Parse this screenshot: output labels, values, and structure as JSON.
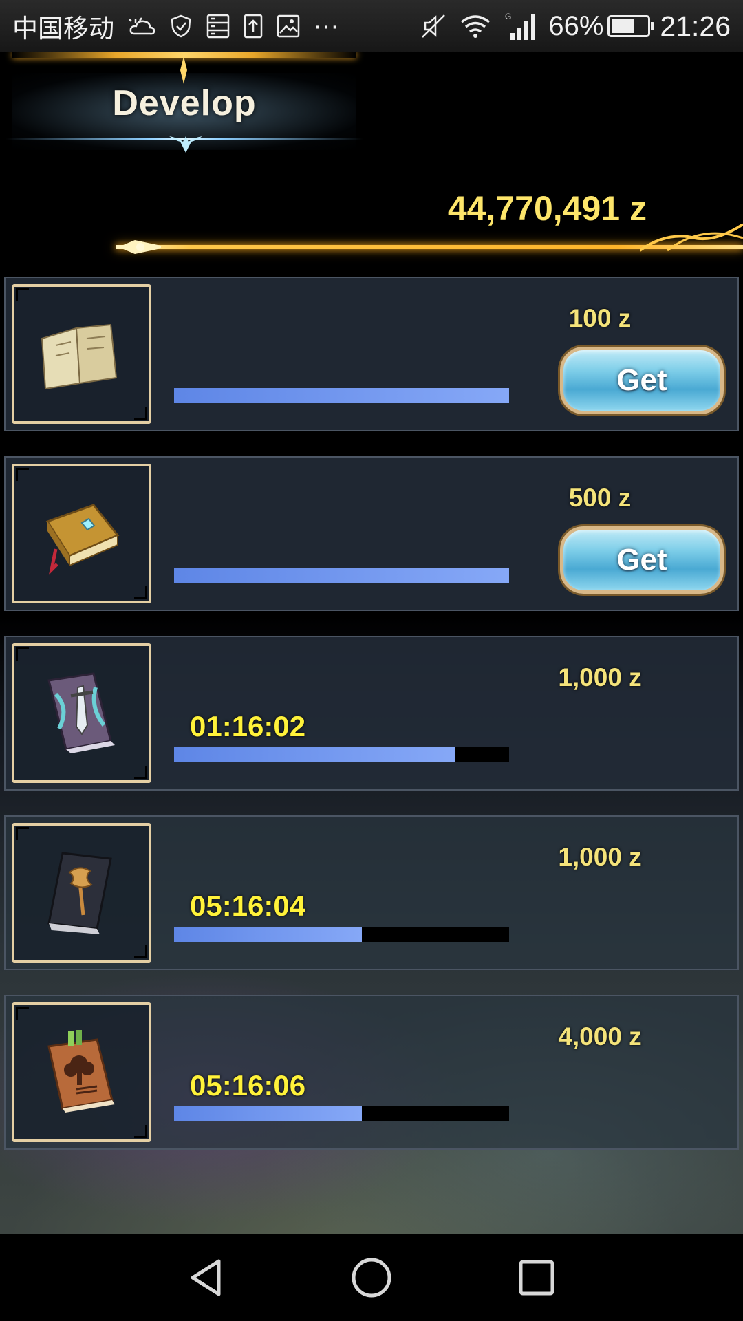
{
  "status_bar": {
    "carrier": "中国移动",
    "network_type": "G",
    "battery_percent_text": "66%",
    "battery_level": 0.66,
    "time": "21:26",
    "overflow": "···"
  },
  "header": {
    "title": "Develop",
    "total_zeny": "44,770,491 z"
  },
  "items": [
    {
      "cost": "100 z",
      "timer": "",
      "progress": 1.0,
      "button_label": "Get",
      "icon": "old-map-book-icon"
    },
    {
      "cost": "500 z",
      "timer": "",
      "progress": 1.0,
      "button_label": "Get",
      "icon": "golden-tome-icon"
    },
    {
      "cost": "1,000 z",
      "timer": "01:16:02",
      "progress": 0.84,
      "button_label": "",
      "icon": "sword-book-icon"
    },
    {
      "cost": "1,000 z",
      "timer": "05:16:04",
      "progress": 0.56,
      "button_label": "",
      "icon": "axe-book-icon"
    },
    {
      "cost": "4,000 z",
      "timer": "05:16:06",
      "progress": 0.56,
      "button_label": "",
      "icon": "tree-book-icon"
    }
  ],
  "colors": {
    "gold": "#fde56a",
    "timer": "#fff23a",
    "progress": "#6f95ee",
    "button": "#7ccde8"
  }
}
